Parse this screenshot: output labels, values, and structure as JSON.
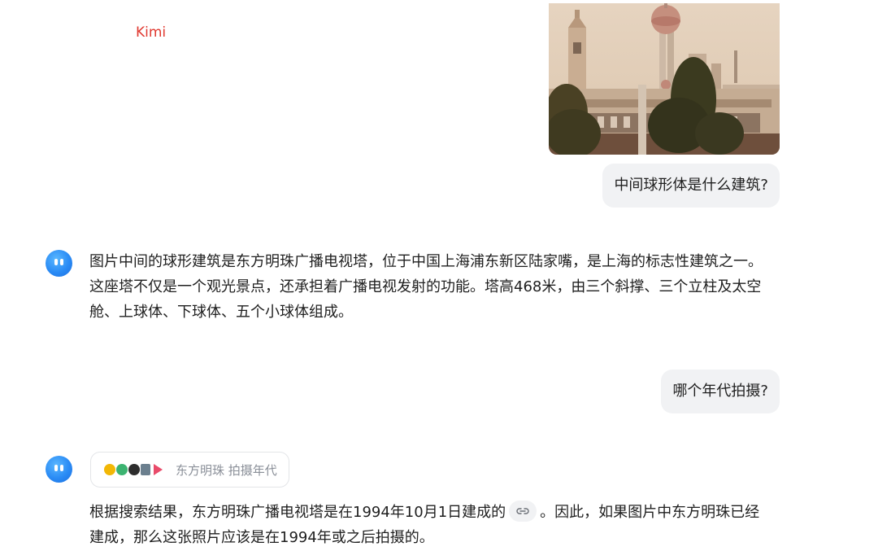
{
  "app": {
    "brand": "Kimi"
  },
  "conversation": {
    "user_image": {
      "subject": "oriental-pearl-tower-photo"
    },
    "q1": "中间球形体是什么建筑?",
    "a1": "图片中间的球形建筑是东方明珠广播电视塔，位于中国上海浦东新区陆家嘴，是上海的标志性建筑之一。这座塔不仅是一个观光景点，还承担着广播电视发射的功能。塔高468米，由三个斜撑、三个立柱及太空舱、上球体、下球体、五个小球体组成。",
    "q2": "哪个年代拍摄?",
    "search": {
      "query": "东方明珠 拍摄年代",
      "source_icons": [
        "source-icon-1",
        "source-icon-2",
        "source-icon-3",
        "source-icon-4",
        "source-icon-5"
      ]
    },
    "a2_part1": "根据搜索结果，东方明珠广播电视塔是在1994年10月1日建成的",
    "citation_icon": "link-icon",
    "a2_part2": "。因此，如果图片中东方明珠已经建成，那么这张照片应该是在1994年或之后拍摄的。"
  },
  "colors": {
    "brand": "#e0382f",
    "user_bubble": "#f1f2f4",
    "avatar": "#2a8bf5"
  }
}
